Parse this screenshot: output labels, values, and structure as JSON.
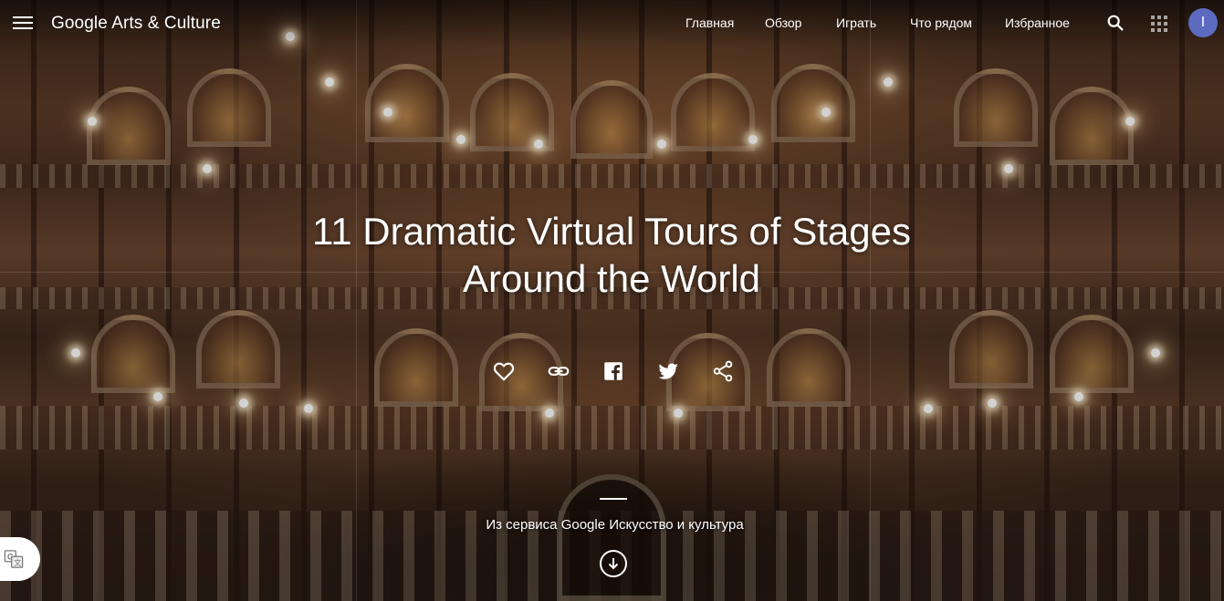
{
  "header": {
    "logo": "Google Arts & Culture",
    "nav": [
      {
        "label": "Главная"
      },
      {
        "label": "Обзор"
      },
      {
        "label": "Играть"
      },
      {
        "label": "Что рядом"
      },
      {
        "label": "Избранное"
      }
    ],
    "avatar_initial": "I",
    "avatar_color": "#5c6bc0"
  },
  "hero": {
    "title_line1": "11 Dramatic Virtual Tours of Stages",
    "title_line2": "Around the World",
    "actions": [
      {
        "icon": "heart-icon"
      },
      {
        "icon": "link-icon"
      },
      {
        "icon": "facebook-icon"
      },
      {
        "icon": "twitter-icon"
      },
      {
        "icon": "share-icon"
      }
    ],
    "source_text": "Из сервиса Google Искусство и культура",
    "scroll_icon": "arrow-down-circle-icon"
  },
  "widgets": {
    "translate_icon": "translate-icon"
  }
}
